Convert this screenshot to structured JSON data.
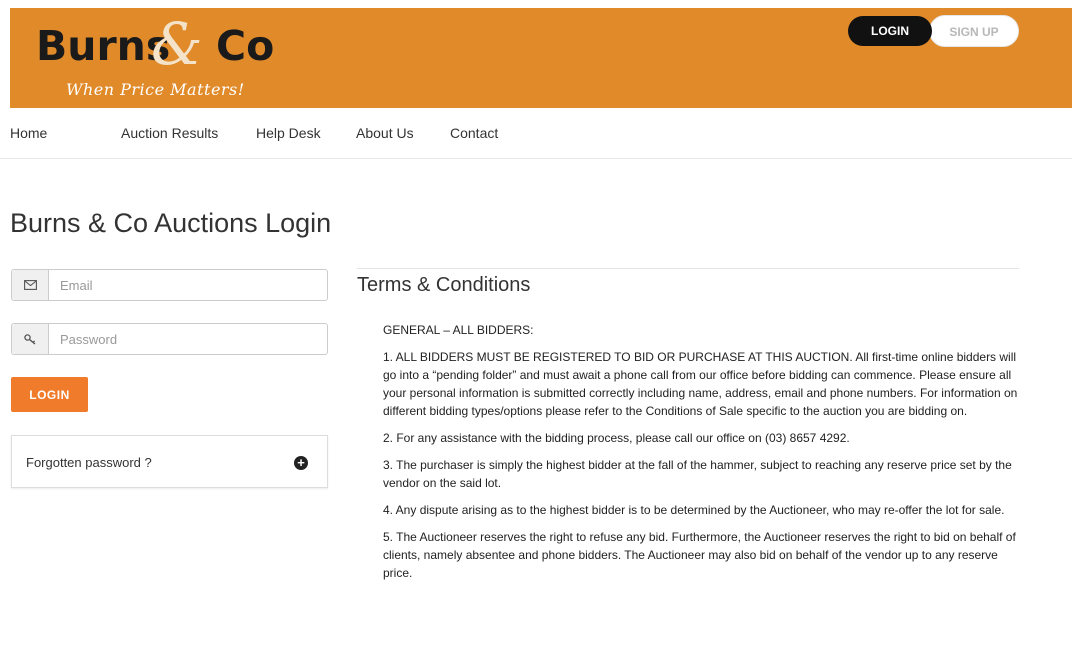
{
  "brand": {
    "name_part1": "Burns",
    "ampersand": "&",
    "name_part2": "Co",
    "tagline": "When Price Matters!"
  },
  "header": {
    "login_label": "LOGIN",
    "signup_label": "SIGN UP"
  },
  "nav": {
    "items": [
      "Home",
      "Auction Results",
      "Help Desk",
      "About Us",
      "Contact"
    ]
  },
  "page_title": "Burns & Co Auctions Login",
  "login_form": {
    "email_placeholder": "Email",
    "password_placeholder": "Password",
    "submit_label": "LOGIN",
    "forgot_label": "Forgotten password ?"
  },
  "terms": {
    "title": "Terms & Conditions",
    "paragraphs": [
      "GENERAL – ALL BIDDERS:",
      "1. ALL BIDDERS MUST BE REGISTERED TO BID OR PURCHASE AT THIS AUCTION. All first-time online bidders will go into a “pending folder” and must await a phone call from our office before bidding can commence. Please ensure all your personal information is submitted correctly including name, address, email and phone numbers. For information on different bidding types/options please refer to the Conditions of Sale specific to the auction you are bidding on.",
      "2. For any assistance with the bidding process, please call our office on (03) 8657 4292.",
      "3. The purchaser is simply the highest bidder at the fall of the hammer, subject to reaching any reserve price set by the vendor on the said lot.",
      "4. Any dispute arising as to the highest bidder is to be determined by the Auctioneer, who may re-offer the lot for sale.",
      "5. The Auctioneer reserves the right to refuse any bid. Furthermore, the Auctioneer reserves the right to bid on behalf of clients, namely absentee and phone bidders. The Auctioneer may also bid on behalf of the vendor up to any reserve price."
    ]
  },
  "colors": {
    "header_bg": "#e08a2a",
    "accent": "#f07b2a",
    "dark": "#111111"
  },
  "icons": {
    "email": "envelope-icon",
    "password": "key-icon",
    "forgot_toggle": "plus-circle-icon"
  }
}
